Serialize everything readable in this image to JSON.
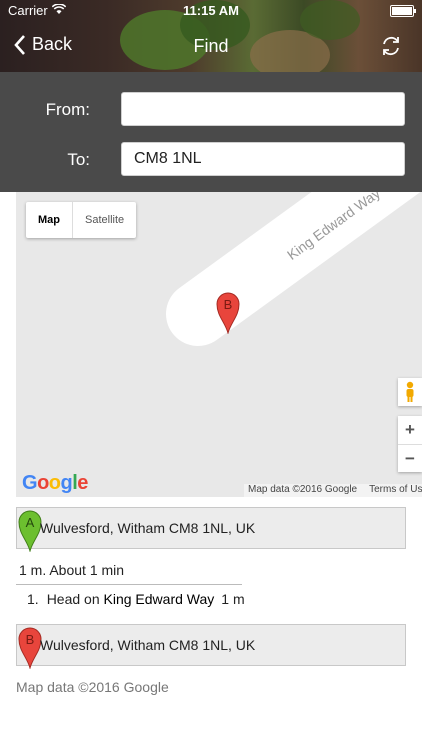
{
  "status_bar": {
    "carrier": "Carrier",
    "time": "11:15 AM"
  },
  "nav": {
    "back_label": "Back",
    "title": "Find"
  },
  "form": {
    "from_label": "From:",
    "from_value": "",
    "to_label": "To:",
    "to_value": "CM8 1NL"
  },
  "map": {
    "type_map": "Map",
    "type_satellite": "Satellite",
    "road_label": "King Edward Way",
    "marker_b": "B",
    "zoom_in": "+",
    "zoom_out": "−",
    "data_label": "Map data ©2016 Google",
    "terms_label": "Terms of Us"
  },
  "directions": {
    "start_marker": "A",
    "start_address": "Wulvesford, Witham CM8 1NL, UK",
    "summary": "1 m. About 1 min",
    "steps": [
      {
        "num": "1.",
        "text": "Head on",
        "road": "King Edward Way",
        "distance": "1 m"
      }
    ],
    "end_marker": "B",
    "end_address": "Wulvesford, Witham CM8 1NL, UK",
    "copyright": "Map data ©2016 Google"
  },
  "colors": {
    "header_bg": "#3a2a25",
    "form_bg": "#4a4a4a",
    "marker_a": "#6cbf2f",
    "marker_b": "#e8453c"
  }
}
